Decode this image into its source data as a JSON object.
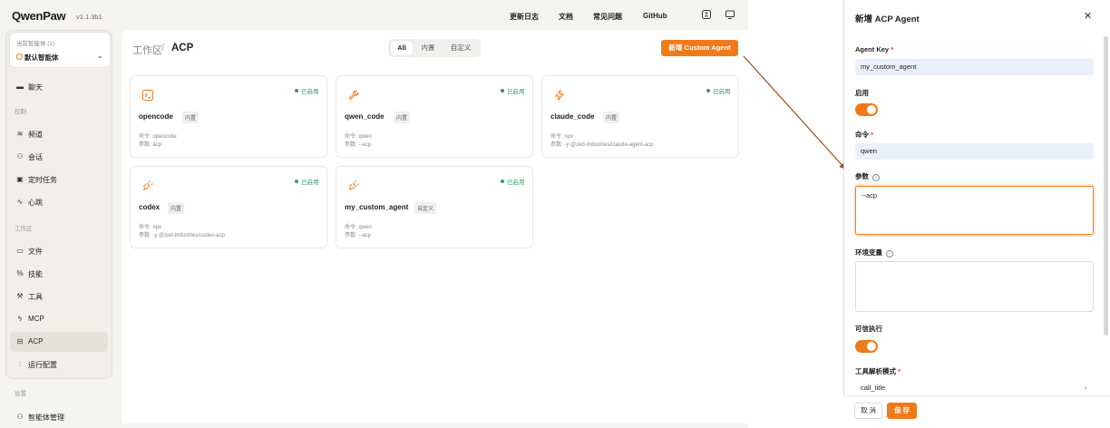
{
  "app": {
    "brand": "QwenPaw",
    "version": "v1.1.3b1",
    "nav": [
      "更新日志",
      "文档",
      "常见问题",
      "GitHub"
    ],
    "accent": "#f07a1a",
    "status_color": "#2e9c63"
  },
  "sidebar": {
    "agent_label": "当前智能体 (2)",
    "agent_name": "默认智能体",
    "chat": "聊天",
    "group_control": "控制",
    "control_items": [
      "频道",
      "会话",
      "定时任务",
      "心跳"
    ],
    "group_workspace": "工作区",
    "workspace_items": [
      "文件",
      "技能",
      "工具",
      "MCP",
      "ACP",
      "运行配置"
    ],
    "group_settings": "设置",
    "settings_items": [
      "智能体管理"
    ]
  },
  "main": {
    "crumb_parent": "工作区",
    "crumb_sep": "/",
    "crumb_current": "ACP",
    "filters": [
      "All",
      "内置",
      "自定义"
    ],
    "new_button": "新增 Custom Agent",
    "cards": [
      {
        "title": "opencode",
        "tag": "内置",
        "status": "已启用",
        "cmd": "命令: opencode",
        "args": "参数: acp",
        "icon": "terminal-icon"
      },
      {
        "title": "qwen_code",
        "tag": "内置",
        "status": "已启用",
        "cmd": "命令: qwen",
        "args": "参数: --acp",
        "icon": "wrench-icon"
      },
      {
        "title": "claude_code",
        "tag": "内置",
        "status": "已启用",
        "cmd": "命令: npx",
        "args": "参数: -y @zed-industries/claude-agent-acp",
        "icon": "lightning-icon"
      },
      {
        "title": "codex",
        "tag": "内置",
        "status": "已启用",
        "cmd": "命令: npx",
        "args": "参数: -y @zed-industries/codex-acp",
        "icon": "plug-icon"
      },
      {
        "title": "my_custom_agent",
        "tag": "自定义",
        "status": "已启用",
        "cmd": "命令: qwen",
        "args": "参数: --acp",
        "icon": "plug-icon"
      }
    ]
  },
  "drawer": {
    "title": "新增 ACP Agent",
    "agent_key_label": "Agent Key",
    "agent_key_value": "my_custom_agent",
    "enabled_label": "启用",
    "command_label": "命令",
    "command_value": "qwen",
    "args_label": "参数",
    "args_value": "--acp",
    "env_label": "环境变量",
    "env_value": "",
    "trusted_label": "可信执行",
    "parser_label": "工具解析模式",
    "parser_value": "call_title",
    "cancel": "取 消",
    "save": "保 存",
    "required_mark": "*"
  }
}
